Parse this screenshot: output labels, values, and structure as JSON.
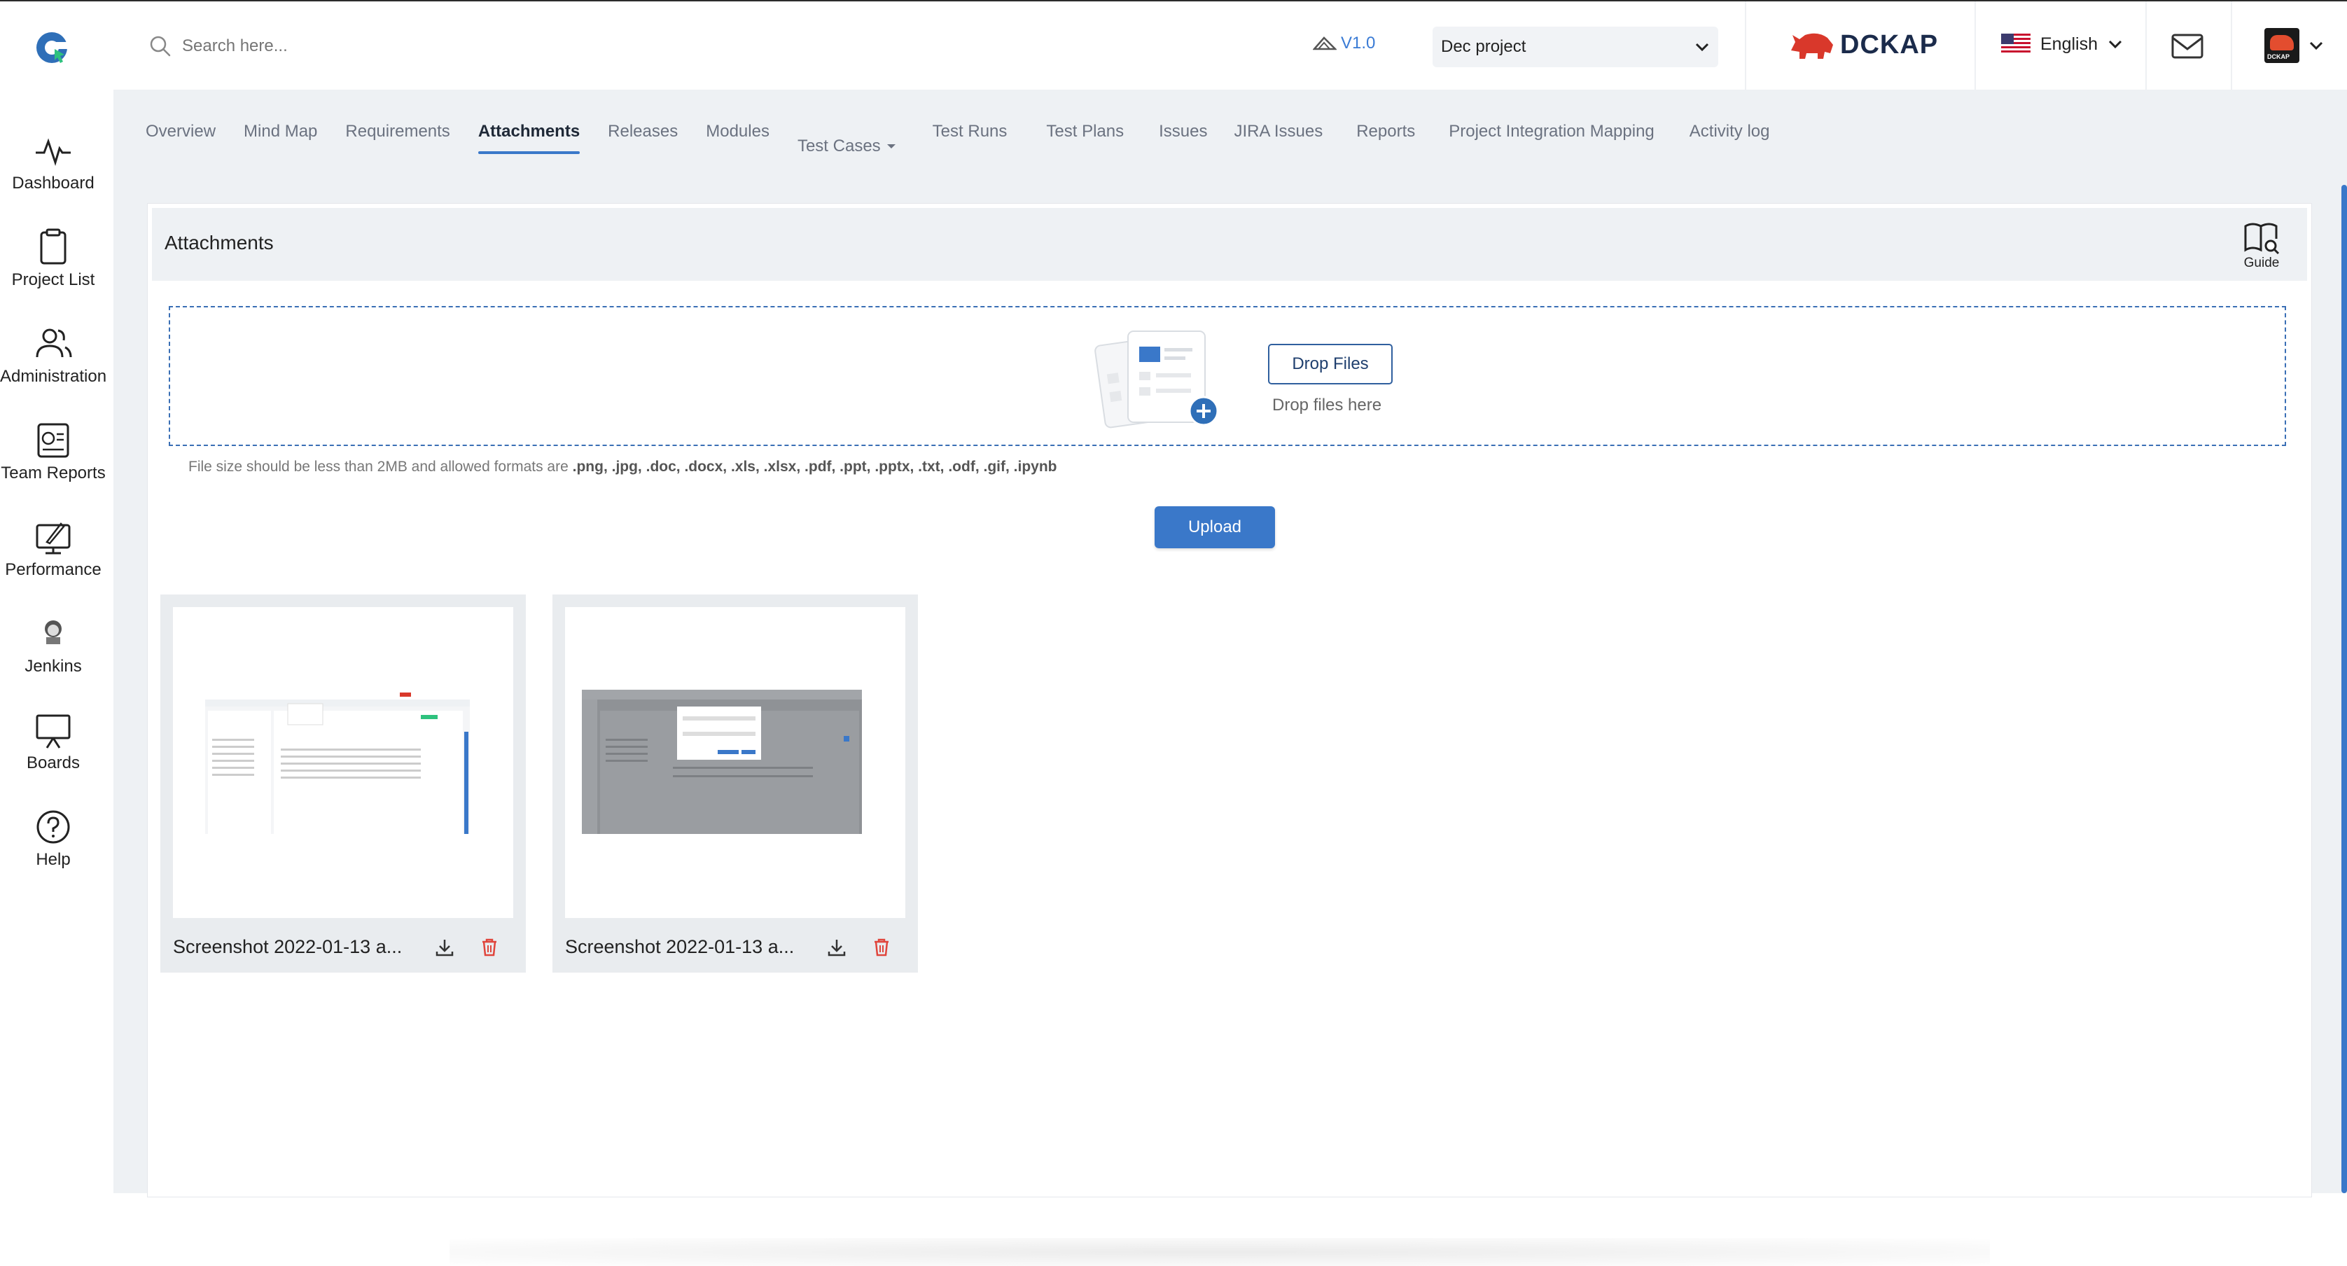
{
  "header": {
    "search_placeholder": "Search here...",
    "version": "V1.0",
    "project_select": "Dec project",
    "brand": "DCKAP",
    "language": "English",
    "avatar_text": "DCKAP"
  },
  "sidebar": {
    "items": [
      {
        "label": "Dashboard",
        "icon": "pulse-icon"
      },
      {
        "label": "Project List",
        "icon": "clipboard-icon"
      },
      {
        "label": "Administration",
        "icon": "users-icon"
      },
      {
        "label": "Team Reports",
        "icon": "report-icon"
      },
      {
        "label": "Performance",
        "icon": "rocket-monitor-icon"
      },
      {
        "label": "Jenkins",
        "icon": "jenkins-icon"
      },
      {
        "label": "Boards",
        "icon": "board-icon"
      },
      {
        "label": "Help",
        "icon": "help-icon"
      }
    ]
  },
  "tabs": [
    {
      "label": "Overview",
      "active": false
    },
    {
      "label": "Mind Map",
      "active": false
    },
    {
      "label": "Requirements",
      "active": false
    },
    {
      "label": "Attachments",
      "active": true
    },
    {
      "label": "Releases",
      "active": false
    },
    {
      "label": "Modules",
      "active": false
    },
    {
      "label": "Test Cases",
      "active": false
    },
    {
      "label": "Test Runs",
      "active": false
    },
    {
      "label": "Test Plans",
      "active": false
    },
    {
      "label": "Issues",
      "active": false
    },
    {
      "label": "JIRA Issues",
      "active": false
    },
    {
      "label": "Reports",
      "active": false
    },
    {
      "label": "Project Integration Mapping",
      "active": false
    },
    {
      "label": "Activity log",
      "active": false
    }
  ],
  "card": {
    "title": "Attachments",
    "guide_label": "Guide",
    "drop_button": "Drop Files",
    "drop_hint": "Drop files here",
    "file_note_prefix": "File size should be less than 2MB and allowed formats are ",
    "file_note_formats": ".png, .jpg, .doc, .docx, .xls, .xlsx, .pdf, .ppt, .pptx, .txt, .odf, .gif, .ipynb",
    "upload_button": "Upload"
  },
  "attachments": [
    {
      "name": "Screenshot 2022-01-13 a..."
    },
    {
      "name": "Screenshot 2022-01-13 a..."
    }
  ],
  "colors": {
    "accent": "#3a78c9",
    "delete": "#e0453c",
    "background": "#eef1f4"
  }
}
